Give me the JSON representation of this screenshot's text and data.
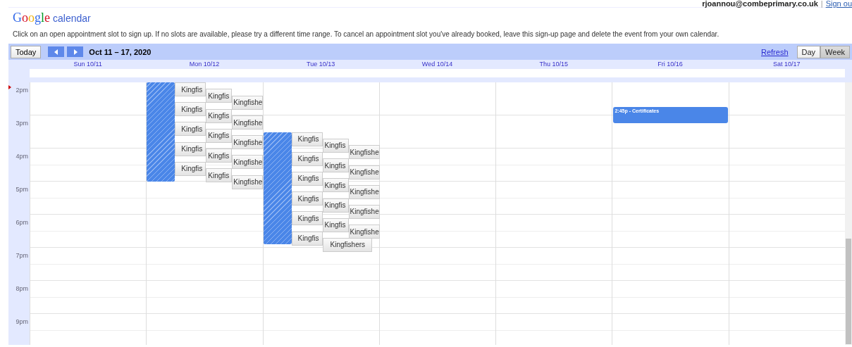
{
  "account": {
    "email": "rjoannou@combeprimary.co.uk",
    "separator": "|",
    "sign_out": "Sign ou"
  },
  "logo": {
    "wordmark": "Google",
    "product": "calendar"
  },
  "instructions": "Click on an open appointment slot to sign up. If no slots are available, please try a different time range. To cancel an appointment slot you've already booked, leave this sign-up page and delete the event from your own calendar.",
  "toolbar": {
    "today": "Today",
    "date_range": "Oct 11 – 17, 2020",
    "refresh": "Refresh",
    "views": [
      {
        "label": "Day",
        "selected": false
      },
      {
        "label": "Week",
        "selected": true
      }
    ]
  },
  "hours": [
    "2pm",
    "3pm",
    "4pm",
    "5pm",
    "6pm",
    "7pm",
    "8pm",
    "9pm"
  ],
  "days": [
    {
      "label": "Sun 10/11"
    },
    {
      "label": "Mon 10/12",
      "slots": [
        {
          "label": "Kingfis"
        },
        {
          "label": "Kingfis"
        },
        {
          "label": "Kingfishe"
        },
        {
          "label": "Kingfis"
        },
        {
          "label": "Kingfis"
        },
        {
          "label": "Kingfishe"
        },
        {
          "label": "Kingfis"
        },
        {
          "label": "Kingfis"
        },
        {
          "label": "Kingfishe"
        },
        {
          "label": "Kingfis"
        },
        {
          "label": "Kingfis"
        },
        {
          "label": "Kingfishe"
        },
        {
          "label": "Kingfis"
        },
        {
          "label": "Kingfis"
        },
        {
          "label": "Kingfishe"
        }
      ]
    },
    {
      "label": "Tue 10/13",
      "slots": [
        {
          "label": "Kingfis"
        },
        {
          "label": "Kingfis"
        },
        {
          "label": "Kingfishe"
        },
        {
          "label": "Kingfis"
        },
        {
          "label": "Kingfis"
        },
        {
          "label": "Kingfishe"
        },
        {
          "label": "Kingfis"
        },
        {
          "label": "Kingfis"
        },
        {
          "label": "Kingfishe"
        },
        {
          "label": "Kingfis"
        },
        {
          "label": "Kingfis"
        },
        {
          "label": "Kingfishe"
        },
        {
          "label": "Kingfis"
        },
        {
          "label": "Kingfis"
        },
        {
          "label": "Kingfishe"
        },
        {
          "label": "Kingfis"
        },
        {
          "label": "Kingfishers"
        }
      ]
    },
    {
      "label": "Wed 10/14"
    },
    {
      "label": "Thu 10/15"
    },
    {
      "label": "Fri 10/16",
      "events": [
        {
          "label": "2:45p - Certificates",
          "color": "#4a86e8"
        }
      ]
    },
    {
      "label": "Sat 10/17"
    }
  ]
}
